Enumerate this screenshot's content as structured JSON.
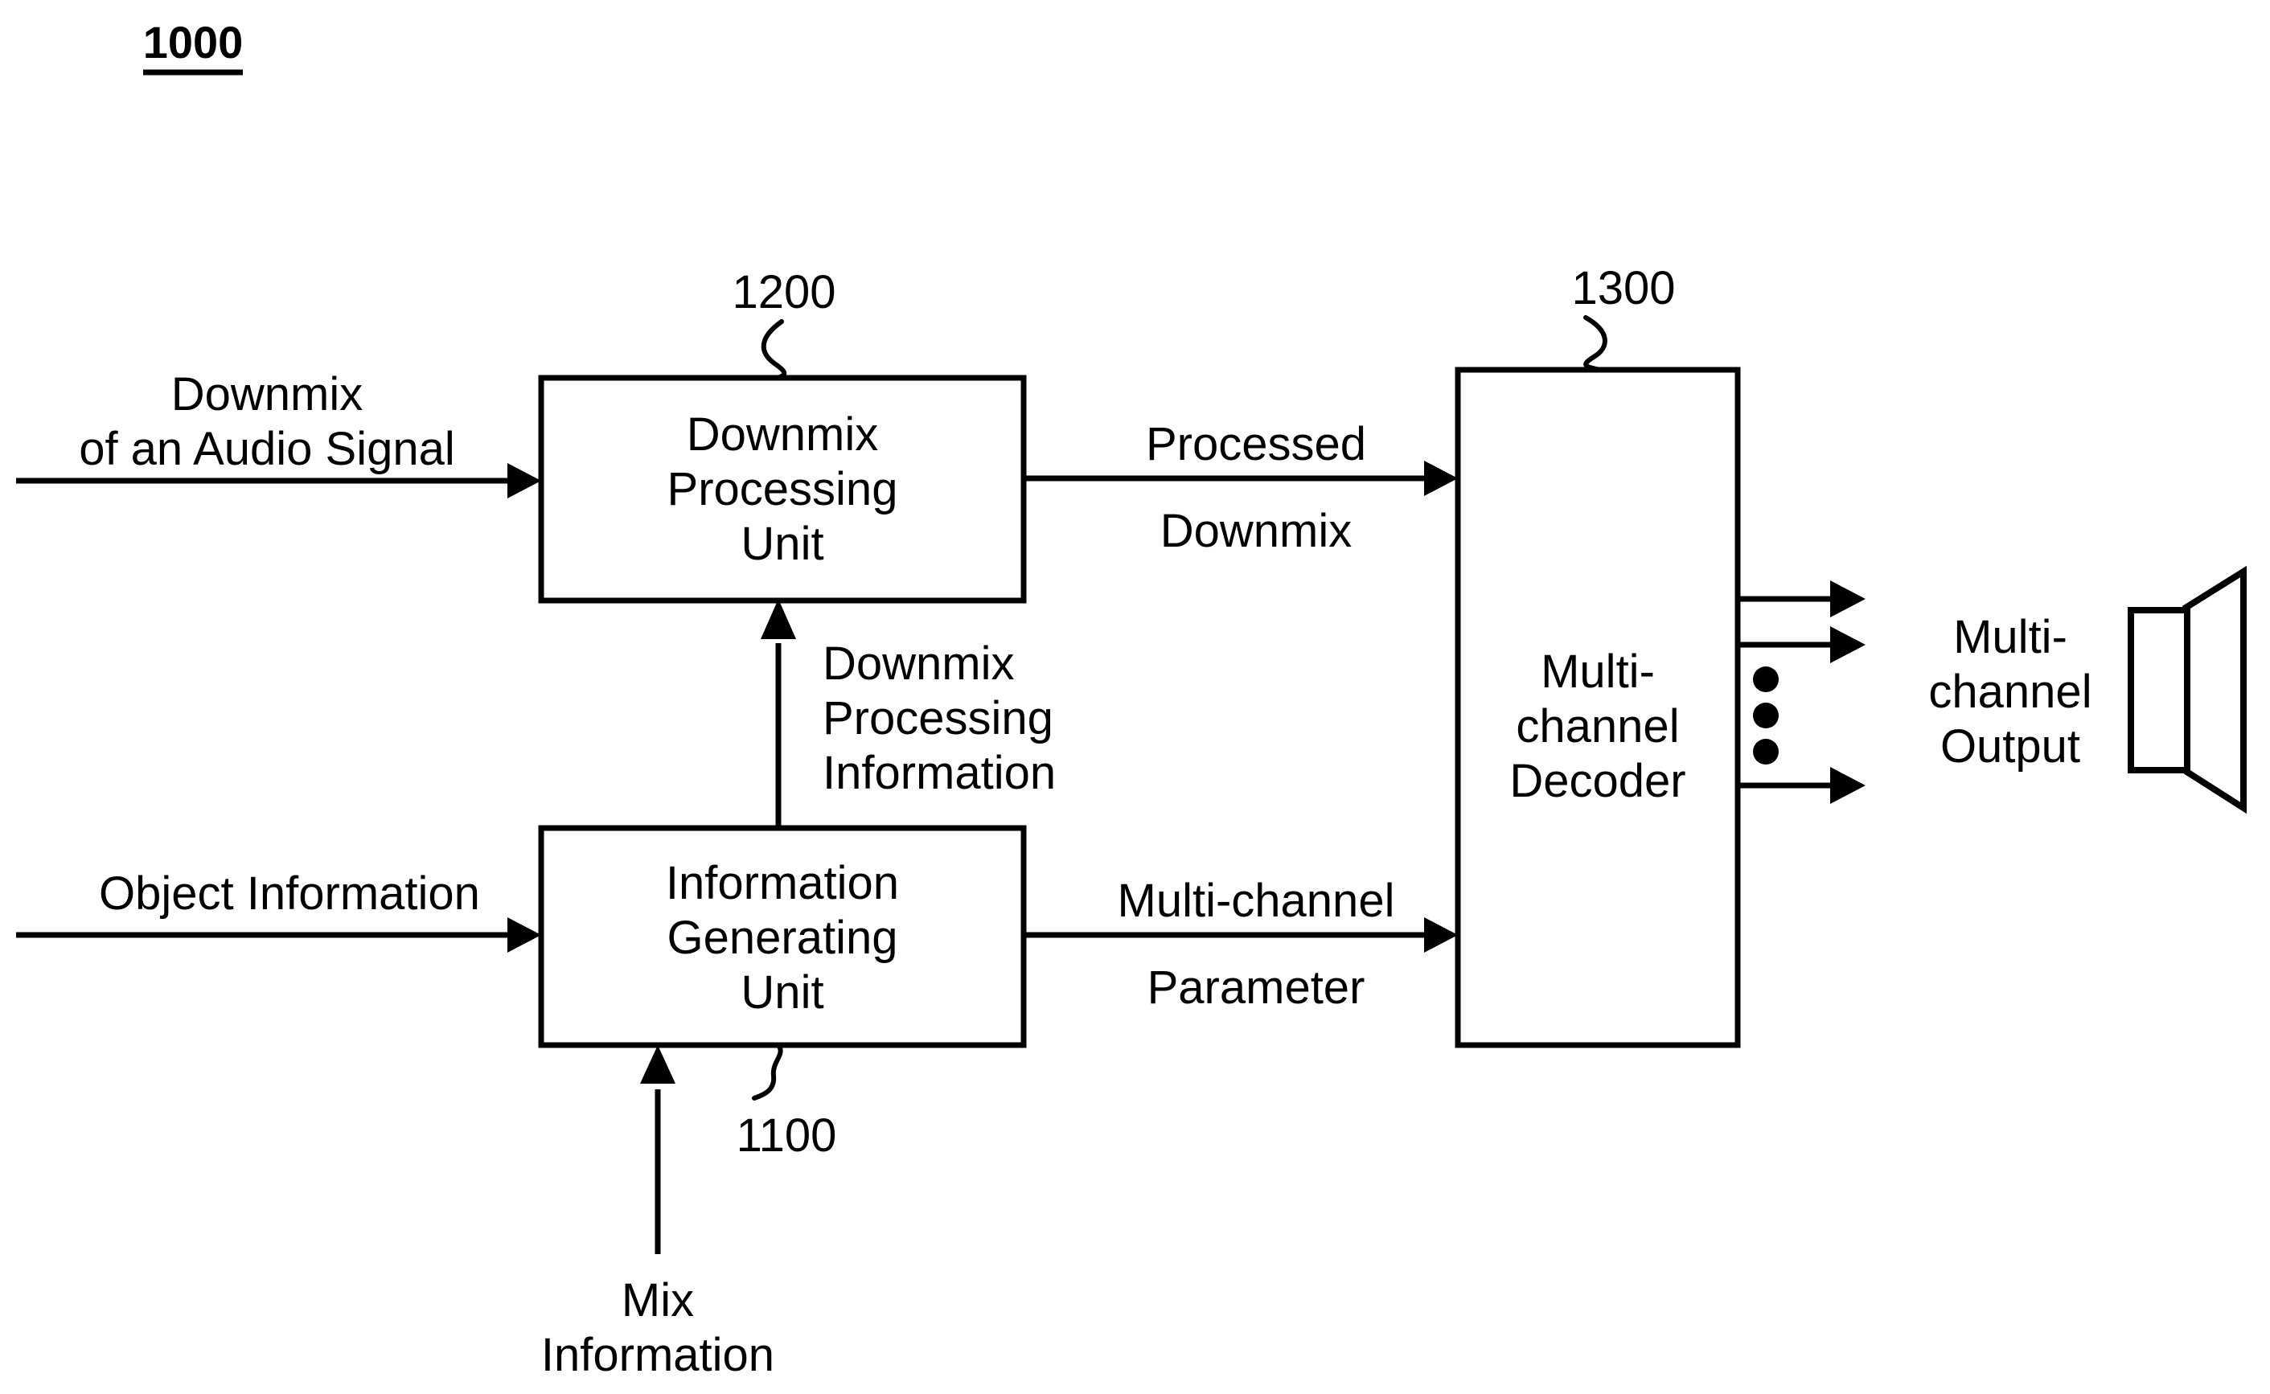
{
  "figure": {
    "figure_number": "1000",
    "blocks": [
      {
        "id": "downmix-processing-unit",
        "ref": "1200",
        "lines": [
          "Downmix",
          "Processing",
          "Unit"
        ]
      },
      {
        "id": "information-generating-unit",
        "ref": "1100",
        "lines": [
          "Information",
          "Generating",
          "Unit"
        ]
      },
      {
        "id": "multi-channel-decoder",
        "ref": "1300",
        "lines": [
          "Multi-",
          "channel",
          "Decoder"
        ]
      }
    ],
    "signals": {
      "downmix_input": [
        "Downmix",
        "of an Audio Signal"
      ],
      "object_information_input": [
        "Object Information"
      ],
      "mix_information_input": [
        "Mix",
        "Information"
      ],
      "downmix_processing_information": [
        "Downmix",
        "Processing",
        "Information"
      ],
      "processed_downmix_above": "Processed",
      "processed_downmix_below": "Downmix",
      "multi_channel_parameter_above": "Multi-channel",
      "multi_channel_parameter_below": "Parameter",
      "multi_channel_output": [
        "Multi-",
        "channel",
        "Output"
      ]
    },
    "icons": {
      "loudspeaker": "loudspeaker-icon",
      "vertical_ellipsis": "vertical-ellipsis-icon"
    },
    "colors": {
      "stroke": "#000000",
      "background": "#ffffff"
    }
  }
}
